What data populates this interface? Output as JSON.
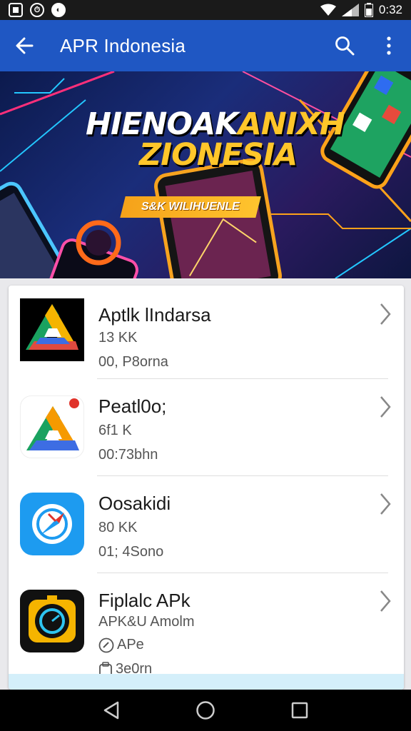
{
  "status_bar": {
    "time": "0:32",
    "left_icons": [
      "square-icon",
      "alarm-icon",
      "circle-app-icon"
    ],
    "right_icons": [
      "wifi-icon",
      "signal-icon",
      "battery-icon"
    ]
  },
  "app_bar": {
    "title": "APR Indonesia",
    "back_icon": "arrow-left-icon",
    "actions": [
      "search-icon",
      "more-vert-icon"
    ],
    "color": "#1f57c3"
  },
  "banner": {
    "line1_white": "HIENOAK",
    "line1_gold": "ANIXH",
    "line2": "ZIONESIA",
    "badge": "O",
    "ribbon": "S&K WILIHUENLE"
  },
  "list": [
    {
      "title": "Aptlk lIndarsa",
      "meta": [
        "13 KK",
        "00, P8orna"
      ],
      "icon": "drive-triangle-icon"
    },
    {
      "title": "Peatl0o;",
      "meta": [
        "6f1 K",
        "00:73bhn"
      ],
      "icon": "drive-triangle-notify-icon"
    },
    {
      "title": "Oosakidi",
      "meta": [
        "80 KK",
        "01; 4Sono"
      ],
      "icon": "compass-icon"
    },
    {
      "title": "Fiplalc APk",
      "meta": [
        "APK&U Amolm",
        "APe",
        "3e0rn"
      ],
      "icon": "camera-timer-icon"
    }
  ],
  "nav": [
    "back-triangle-icon",
    "home-circle-icon",
    "recents-square-icon"
  ]
}
